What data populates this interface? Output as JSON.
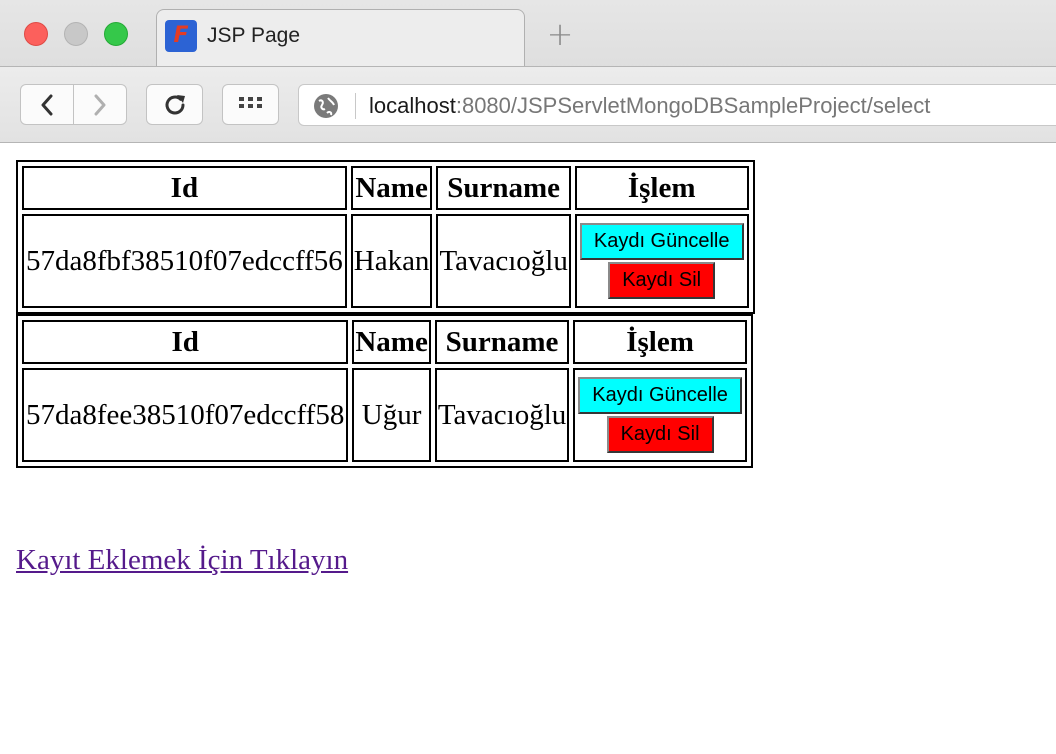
{
  "browser": {
    "tab_title": "JSP Page",
    "url_host": "localhost",
    "url_rest": ":8080/JSPServletMongoDBSampleProject/select",
    "new_tab_glyph": "+"
  },
  "headers": {
    "id": "Id",
    "name": "Name",
    "surname": "Surname",
    "action": "İşlem"
  },
  "records": [
    {
      "id": "57da8fbf38510f07edccff56",
      "name": "Hakan",
      "surname": "Tavacıoğlu"
    },
    {
      "id": "57da8fee38510f07edccff58",
      "name": "Uğur",
      "surname": "Tavacıoğlu"
    }
  ],
  "buttons": {
    "update_label": "Kaydı Güncelle",
    "delete_label": "Kaydı Sil",
    "update_color": "#00ffff",
    "delete_color": "#ff0000"
  },
  "add_link": {
    "label": "Kayıt Eklemek İçin Tıklayın",
    "color": "#551a8b"
  },
  "icons": {
    "favicon": "jsp-favicon-icon",
    "back": "chevron-left-icon",
    "forward": "chevron-right-icon",
    "reload": "reload-icon",
    "apps": "grid-icon",
    "site": "globe-icon"
  }
}
